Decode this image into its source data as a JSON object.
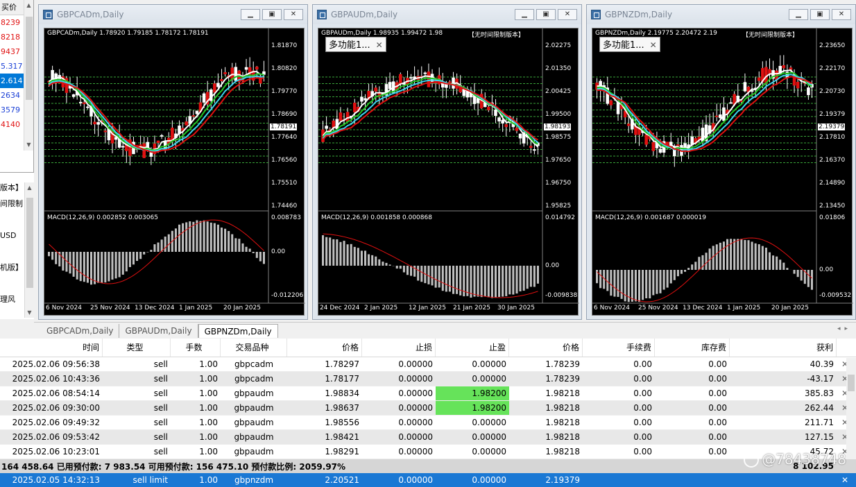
{
  "market_watch": {
    "header": "买价",
    "rows": [
      {
        "text": "8239",
        "dir": "down"
      },
      {
        "text": "8218",
        "dir": "down"
      },
      {
        "text": "9437",
        "dir": "down"
      },
      {
        "text": "5.317",
        "dir": "up"
      },
      {
        "text": "2.614",
        "dir": "sel"
      },
      {
        "text": "2634",
        "dir": "up"
      },
      {
        "text": "3579",
        "dir": "up"
      },
      {
        "text": "4140",
        "dir": "down"
      }
    ]
  },
  "news": {
    "rows": [
      "版本】",
      "间限制",
      "",
      "USD",
      "",
      "机版】",
      "",
      "理风"
    ]
  },
  "charts": [
    {
      "window_title": "GBPCADm,Daily",
      "header": "GBPCADm,Daily  1.78920 1.79185 1.78172 1.78191",
      "price_labels": [
        "1.81870",
        "1.80820",
        "1.79770",
        "1.78690",
        "1.77640",
        "1.76560",
        "1.75510",
        "1.74460"
      ],
      "current_price": "1.78191",
      "macd_label": "MACD(12,26,9) 0.002852 0.003065",
      "macd_axis": [
        "0.008783",
        "0.00",
        "-0.012206"
      ],
      "dates": [
        "6 Nov 2024",
        "25 Nov 2024",
        "13 Dec 2024",
        "1 Jan 2025",
        "20 Jan 2025"
      ],
      "popup": null
    },
    {
      "window_title": "GBPAUDm,Daily",
      "header": "GBPAUDm,Daily  1.98935 1.99472 1.98",
      "header_right": "【无时间限制版本】",
      "price_labels": [
        "2.02275",
        "2.01350",
        "2.00425",
        "1.99500",
        "1.98575",
        "1.97650",
        "1.96750",
        "1.95825"
      ],
      "current_price": "1.98193",
      "macd_label": "MACD(12,26,9) 0.001858 0.000868",
      "macd_axis": [
        "0.014792",
        "0.00",
        "-0.009838"
      ],
      "dates": [
        "24 Dec 2024",
        "2 Jan 2025",
        "12 Jan 2025",
        "21 Jan 2025",
        "30 Jan 2025"
      ],
      "popup": "多功能1..."
    },
    {
      "window_title": "GBPNZDm,Daily",
      "header": "GBPNZDm,Daily  2.19775 2.20472 2.19",
      "header_right": "【无时间限制版本】",
      "price_labels": [
        "2.23650",
        "2.22170",
        "2.20730",
        "2.19379",
        "2.17810",
        "2.16370",
        "2.14890",
        "2.13450"
      ],
      "current_price": "2.19379",
      "macd_label": "MACD(12,26,9) 0.001687 0.000019",
      "macd_axis": [
        "0.01806",
        "0.00",
        "-0.009532"
      ],
      "dates": [
        "6 Nov 2024",
        "25 Nov 2024",
        "13 Dec 2024",
        "1 Jan 2025",
        "20 Jan 2025"
      ],
      "popup": "多功能1..."
    }
  ],
  "chart_tabs": [
    "GBPCADm,Daily",
    "GBPAUDm,Daily",
    "GBPNZDm,Daily"
  ],
  "active_tab": 2,
  "table": {
    "columns": [
      "时间",
      "类型",
      "手数",
      "交易品种",
      "价格",
      "止损",
      "止盈",
      "价格",
      "手续费",
      "库存费",
      "获利"
    ],
    "rows": [
      [
        "2025.02.06 09:56:38",
        "sell",
        "1.00",
        "gbpcadm",
        "1.78297",
        "0.00000",
        "0.00000",
        "1.78239",
        "0.00",
        "0.00",
        "40.39"
      ],
      [
        "2025.02.06 10:43:36",
        "sell",
        "1.00",
        "gbpcadm",
        "1.78177",
        "0.00000",
        "0.00000",
        "1.78239",
        "0.00",
        "0.00",
        "-43.17"
      ],
      [
        "2025.02.06 08:54:14",
        "sell",
        "1.00",
        "gbpaudm",
        "1.98834",
        "0.00000",
        "1.98200",
        "1.98218",
        "0.00",
        "0.00",
        "385.83"
      ],
      [
        "2025.02.06 09:30:00",
        "sell",
        "1.00",
        "gbpaudm",
        "1.98637",
        "0.00000",
        "1.98200",
        "1.98218",
        "0.00",
        "0.00",
        "262.44"
      ],
      [
        "2025.02.06 09:49:32",
        "sell",
        "1.00",
        "gbpaudm",
        "1.98556",
        "0.00000",
        "0.00000",
        "1.98218",
        "0.00",
        "0.00",
        "211.71"
      ],
      [
        "2025.02.06 09:53:42",
        "sell",
        "1.00",
        "gbpaudm",
        "1.98421",
        "0.00000",
        "0.00000",
        "1.98218",
        "0.00",
        "0.00",
        "127.15"
      ],
      [
        "2025.02.06 10:23:01",
        "sell",
        "1.00",
        "gbpaudm",
        "1.98291",
        "0.00000",
        "0.00000",
        "1.98218",
        "0.00",
        "0.00",
        "45.72"
      ]
    ],
    "summary": "164 458.64  已用预付款: 7 983.54  可用预付款: 156 475.10  预付款比例: 2059.97%",
    "summary_total": "8 102.95",
    "pending": [
      "2025.02.05 14:32:13",
      "sell limit",
      "1.00",
      "gbpnzdm",
      "2.20521",
      "0.00000",
      "0.00000",
      "2.19379",
      "",
      "",
      ""
    ]
  },
  "watermark": "@78438748"
}
